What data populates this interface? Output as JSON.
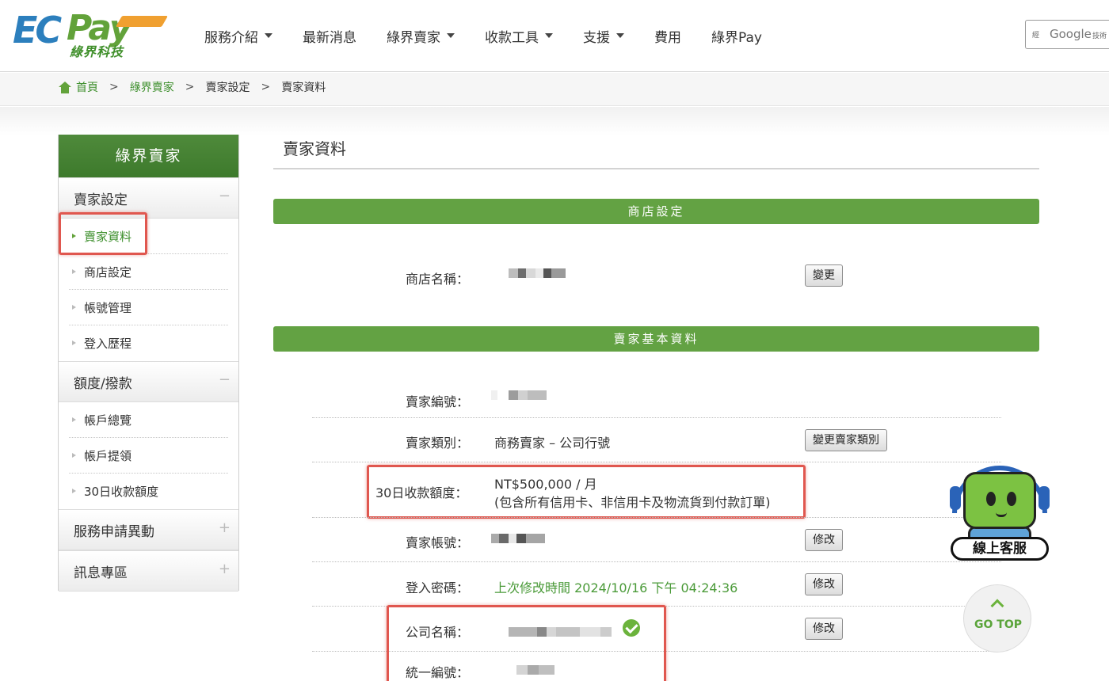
{
  "brand": {
    "logo_ec": "EC",
    "logo_pay": "Pay",
    "logo_sub": "綠界科技",
    "accent": "#63a243",
    "blue": "#2c7fbd"
  },
  "nav": {
    "items": [
      {
        "label": "服務介紹",
        "dropdown": true
      },
      {
        "label": "最新消息",
        "dropdown": false
      },
      {
        "label": "綠界賣家",
        "dropdown": true
      },
      {
        "label": "收款工具",
        "dropdown": true
      },
      {
        "label": "支援",
        "dropdown": true
      },
      {
        "label": "費用",
        "dropdown": false
      },
      {
        "label": "綠界Pay",
        "dropdown": false
      }
    ],
    "search": {
      "prefix": "經",
      "google": "Google",
      "suffix": "技術"
    }
  },
  "breadcrumb": {
    "home": "首頁",
    "sep": ">",
    "level1": "綠界賣家",
    "level2": "賣家設定",
    "current": "賣家資料"
  },
  "sidebar": {
    "title": "綠界賣家",
    "sections": [
      {
        "title": "賣家設定",
        "toggle": "−",
        "items": [
          "賣家資料",
          "商店設定",
          "帳號管理",
          "登入歷程"
        ]
      },
      {
        "title": "額度/撥款",
        "toggle": "−",
        "items": [
          "帳戶總覽",
          "帳戶提領",
          "30日收款額度"
        ]
      },
      {
        "title": "服務申請異動",
        "toggle": "+",
        "items": []
      },
      {
        "title": "訊息專區",
        "toggle": "+",
        "items": []
      }
    ]
  },
  "main": {
    "title": "賣家資料",
    "store_section": {
      "title": "商店設定",
      "store_name_label": "商店名稱：",
      "change_btn": "變更"
    },
    "seller_section": {
      "title": "賣家基本資料",
      "seller_no_label": "賣家編號：",
      "seller_type_label": "賣家類別：",
      "seller_type_value": "商務賣家 – 公司行號",
      "change_type_btn": "變更賣家類別",
      "limit_label": "30日收款額度：",
      "limit_value": "NT$500,000 / 月",
      "limit_note": "(包含所有信用卡、非信用卡及物流貨到付款訂單)",
      "account_label": "賣家帳號：",
      "account_edit_btn": "修改",
      "password_label": "登入密碼：",
      "password_value": "上次修改時間 2024/10/16 下午 04:24:36",
      "password_edit_btn": "修改",
      "company_label": "公司名稱：",
      "company_edit_btn": "修改",
      "tax_id_label": "統一編號："
    }
  },
  "widgets": {
    "support_label": "線上客服",
    "go_top": "GO TOP"
  }
}
